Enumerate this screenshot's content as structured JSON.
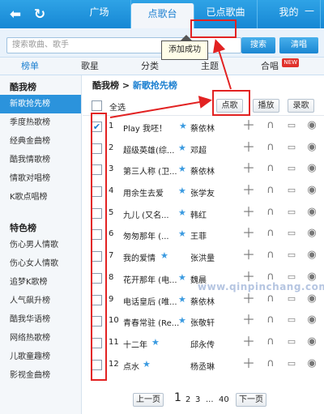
{
  "nav": {
    "back_icon": "back-arrow-icon",
    "refresh_icon": "refresh-icon",
    "tabs": [
      {
        "label": "广场"
      },
      {
        "label": "点歌台"
      },
      {
        "label": "已点歌曲"
      },
      {
        "label": "我的"
      }
    ],
    "active_tab": "点歌台"
  },
  "search": {
    "placeholder": "搜索歌曲、歌手",
    "search_label": "搜索",
    "clear_label": "清唱"
  },
  "toast": "添加成功",
  "categories": [
    {
      "label": "榜单"
    },
    {
      "label": "歌星"
    },
    {
      "label": "分类"
    },
    {
      "label": "主题"
    },
    {
      "label": "合唱",
      "badge": "NEW"
    }
  ],
  "sidebar": {
    "section1_title": "酷我榜",
    "section1": [
      "新歌抢先榜",
      "季度热歌榜",
      "经典金曲榜",
      "酷我情歌榜",
      "情歌对唱榜",
      "K歌点唱榜"
    ],
    "section2_title": "特色榜",
    "section2": [
      "伤心男人情歌",
      "伤心女人情歌",
      "追梦K歌榜",
      "人气飙升榜",
      "酷我华语榜",
      "网络热歌榜",
      "儿歌童趣榜",
      "影视金曲榜"
    ]
  },
  "main": {
    "breadcrumb_parent": "酷我榜 >",
    "breadcrumb_current": "新歌抢先榜",
    "select_all": "全选",
    "btn_request": "点歌",
    "btn_play": "播放",
    "btn_record": "录歌",
    "songs": [
      {
        "num": "1",
        "title": "Play 我呸！",
        "artist": "蔡依林",
        "checked": true
      },
      {
        "num": "2",
        "title": "超级英雄(综...",
        "artist": "邓超",
        "checked": false
      },
      {
        "num": "3",
        "title": "第三人称 (卫...",
        "artist": "蔡依林",
        "checked": false
      },
      {
        "num": "4",
        "title": "用余生去爱",
        "artist": "张学友",
        "checked": false
      },
      {
        "num": "5",
        "title": "九儿 (又名...",
        "artist": "韩红",
        "checked": false
      },
      {
        "num": "6",
        "title": "匆匆那年 (...",
        "artist": "王菲",
        "checked": false
      },
      {
        "num": "7",
        "title": "我的爱情",
        "artist": "张洪量",
        "checked": false
      },
      {
        "num": "8",
        "title": "花开那年 (电...",
        "artist": "魏晨",
        "checked": false
      },
      {
        "num": "9",
        "title": "电话皇后 (唯...",
        "artist": "蔡依林",
        "checked": false
      },
      {
        "num": "10",
        "title": "青春常驻 (Re...",
        "artist": "张敬轩",
        "checked": false
      },
      {
        "num": "11",
        "title": "十二年",
        "artist": "邱永传",
        "checked": false
      },
      {
        "num": "12",
        "title": "点水",
        "artist": "杨丞琳",
        "checked": false
      }
    ]
  },
  "pager": {
    "prev": "上一页",
    "current": "1",
    "p2": "2",
    "p3": "3",
    "ellipsis": "...",
    "last": "40",
    "next": "下一页"
  },
  "watermark": "www.qinpinchang.com",
  "colors": {
    "accent": "#1b7fd0",
    "annotation": "#e22222"
  }
}
